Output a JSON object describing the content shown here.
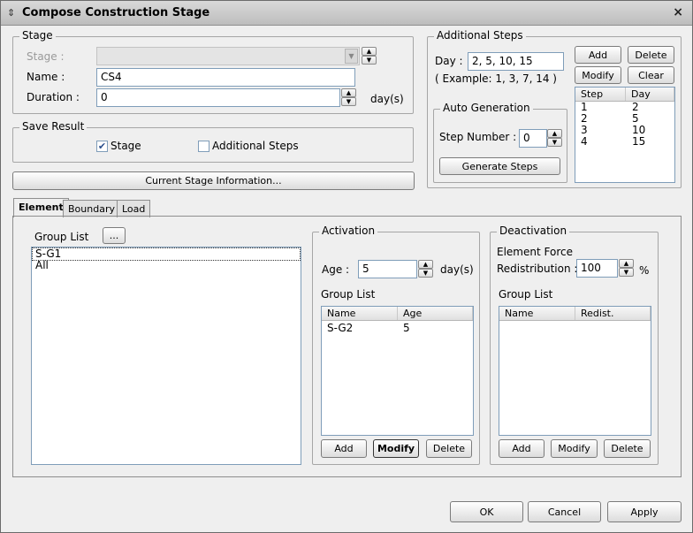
{
  "window": {
    "title": "Compose Construction Stage",
    "close_glyph": "×"
  },
  "stage_group": {
    "legend": "Stage",
    "stage_label": "Stage :",
    "stage_value": "",
    "name_label": "Name :",
    "name_value": "CS4",
    "duration_label": "Duration :",
    "duration_value": "0",
    "duration_unit": "day(s)"
  },
  "save_result": {
    "legend": "Save Result",
    "stage_label": "Stage",
    "stage_checked": true,
    "additional_label": "Additional Steps",
    "additional_checked": false
  },
  "current_stage_button": "Current Stage Information...",
  "additional_steps": {
    "legend": "Additional Steps",
    "day_label": "Day :",
    "day_value": "2, 5, 10, 15",
    "example": "( Example: 1, 3, 7, 14 )",
    "add_label": "Add",
    "delete_label": "Delete",
    "modify_label": "Modify",
    "clear_label": "Clear",
    "columns": [
      "Step",
      "Day"
    ],
    "rows": [
      [
        "1",
        "2"
      ],
      [
        "2",
        "5"
      ],
      [
        "3",
        "10"
      ],
      [
        "4",
        "15"
      ]
    ],
    "auto_generation": {
      "legend": "Auto Generation",
      "step_number_label": "Step Number :",
      "step_number_value": "0",
      "generate_label": "Generate Steps"
    }
  },
  "tabs": [
    "Element",
    "Boundary",
    "Load"
  ],
  "group_list": {
    "label": "Group List",
    "browse_label": "...",
    "items": [
      "S-G1",
      "All"
    ]
  },
  "activation": {
    "legend": "Activation",
    "age_label": "Age :",
    "age_value": "5",
    "age_unit": "day(s)",
    "group_list_label": "Group List",
    "columns": [
      "Name",
      "Age"
    ],
    "rows": [
      [
        "S-G2",
        "5"
      ]
    ],
    "add_label": "Add",
    "modify_label": "Modify",
    "delete_label": "Delete"
  },
  "deactivation": {
    "legend": "Deactivation",
    "force_label": "Element Force",
    "redist_label": "Redistribution :",
    "redist_value": "100",
    "redist_unit": "%",
    "group_list_label": "Group List",
    "columns": [
      "Name",
      "Redist."
    ],
    "rows": [],
    "add_label": "Add",
    "modify_label": "Modify",
    "delete_label": "Delete"
  },
  "footer": {
    "ok_label": "OK",
    "cancel_label": "Cancel",
    "apply_label": "Apply"
  }
}
